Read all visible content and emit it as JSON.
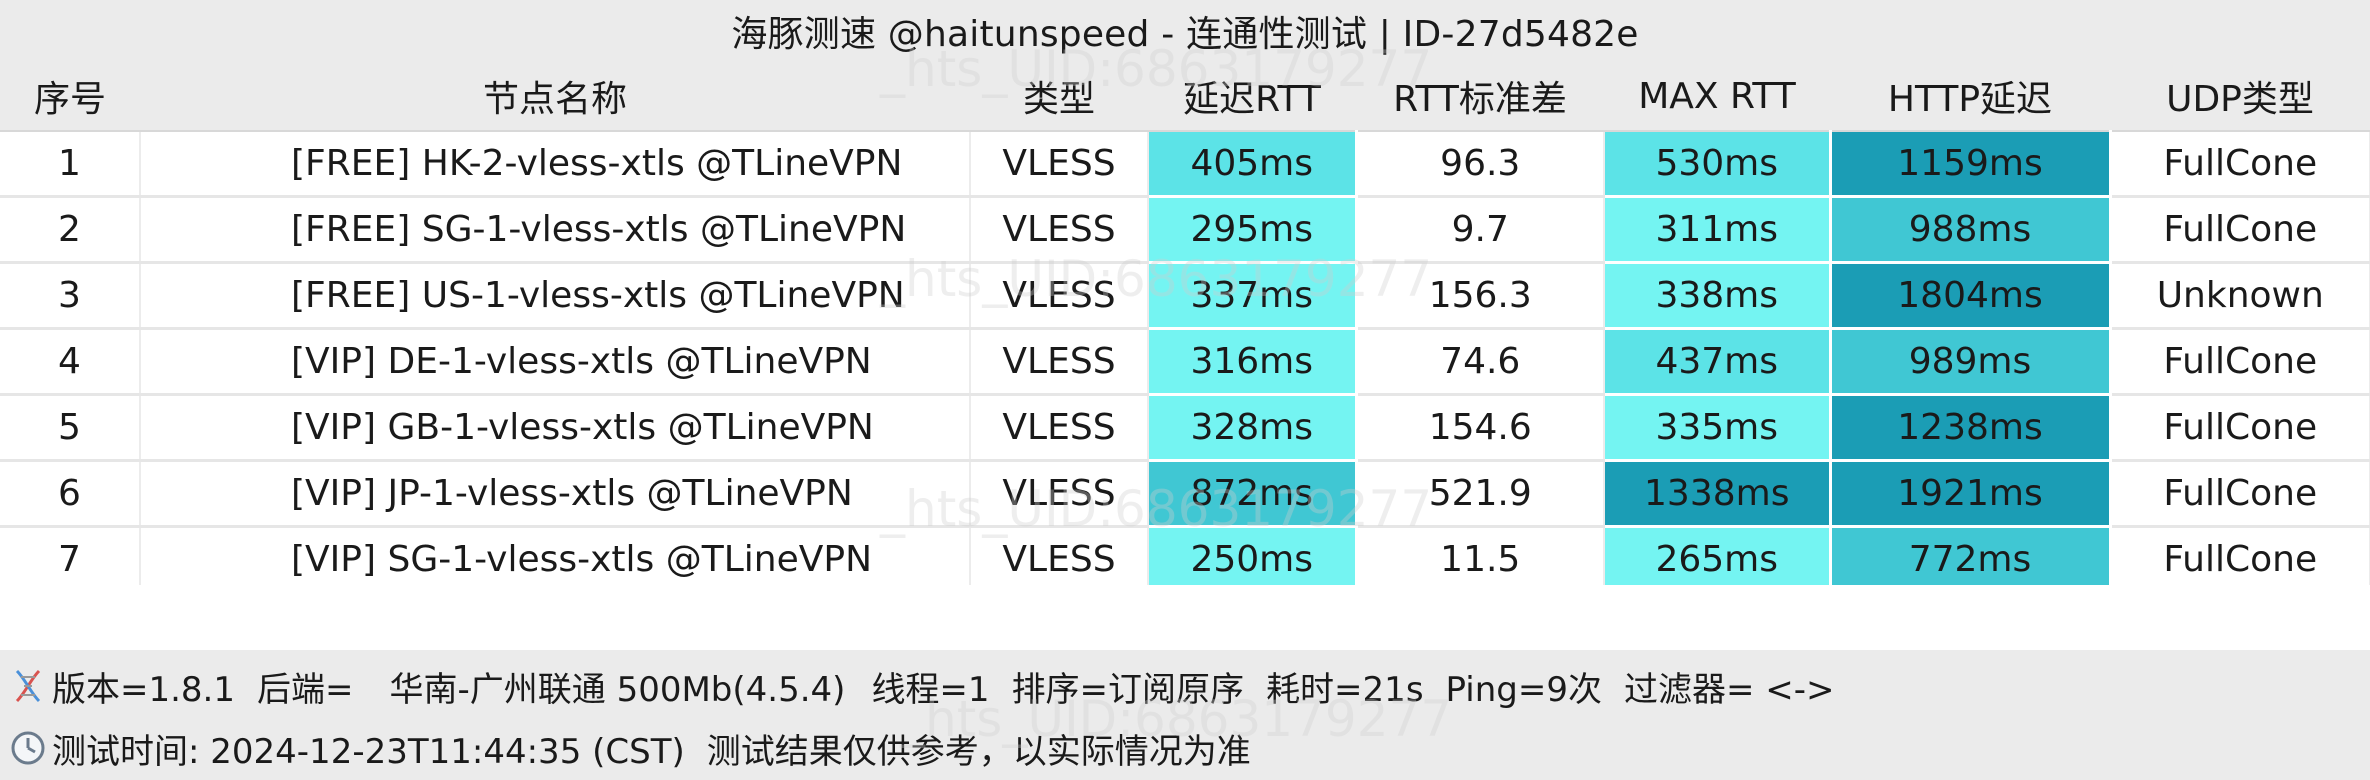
{
  "title": "海豚测速 @haitunspeed - 连通性测试 | ID-27d5482e",
  "columns": [
    "序号",
    "节点名称",
    "类型",
    "延迟RTT",
    "RTT标准差",
    "MAX RTT",
    "HTTP延迟",
    "UDP类型"
  ],
  "rows": [
    {
      "index": "1",
      "name": "[FREE] HK-2-vless-xtls @TLineVPN",
      "type": "VLESS",
      "rtt": "405ms",
      "rtt_std": "96.3",
      "max_rtt": "530ms",
      "http_delay": "1159ms",
      "udp_type": "FullCone"
    },
    {
      "index": "2",
      "name": "[FREE] SG-1-vless-xtls @TLineVPN",
      "type": "VLESS",
      "rtt": "295ms",
      "rtt_std": "9.7",
      "max_rtt": "311ms",
      "http_delay": "988ms",
      "udp_type": "FullCone"
    },
    {
      "index": "3",
      "name": "[FREE] US-1-vless-xtls @TLineVPN",
      "type": "VLESS",
      "rtt": "337ms",
      "rtt_std": "156.3",
      "max_rtt": "338ms",
      "http_delay": "1804ms",
      "udp_type": "Unknown"
    },
    {
      "index": "4",
      "name": "[VIP] DE-1-vless-xtls @TLineVPN",
      "type": "VLESS",
      "rtt": "316ms",
      "rtt_std": "74.6",
      "max_rtt": "437ms",
      "http_delay": "989ms",
      "udp_type": "FullCone"
    },
    {
      "index": "5",
      "name": "[VIP] GB-1-vless-xtls @TLineVPN",
      "type": "VLESS",
      "rtt": "328ms",
      "rtt_std": "154.6",
      "max_rtt": "335ms",
      "http_delay": "1238ms",
      "udp_type": "FullCone"
    },
    {
      "index": "6",
      "name": "[VIP] JP-1-vless-xtls @TLineVPN",
      "type": "VLESS",
      "rtt": "872ms",
      "rtt_std": "521.9",
      "max_rtt": "1338ms",
      "http_delay": "1921ms",
      "udp_type": "FullCone"
    },
    {
      "index": "7",
      "name": "[VIP] SG-1-vless-xtls @TLineVPN",
      "type": "VLESS",
      "rtt": "250ms",
      "rtt_std": "11.5",
      "max_rtt": "265ms",
      "http_delay": "772ms",
      "udp_type": "FullCone"
    }
  ],
  "footer": {
    "version": "版本=1.8.1",
    "backend": "后端=",
    "backend_value": "华南-广州联通 500Mb(4.5.4)",
    "threads": "线程=1",
    "sort": "排序=订阅原序",
    "duration": "耗时=21s",
    "ping": "Ping=9次",
    "filter": "过滤器= <->",
    "test_time": "测试时间: 2024-12-23T11:44:35 (CST)",
    "disclaimer": "测试结果仅供参考，以实际情况为准"
  },
  "watermark": "_hts_UID:6863179277",
  "icons": {
    "version": "dna-icon",
    "time": "clock-icon"
  },
  "colors": {
    "header_bg": "#ebebeb",
    "heat_palette": [
      "#74f4f2",
      "#5ce3e7",
      "#40c7d3",
      "#1b9db5"
    ]
  }
}
